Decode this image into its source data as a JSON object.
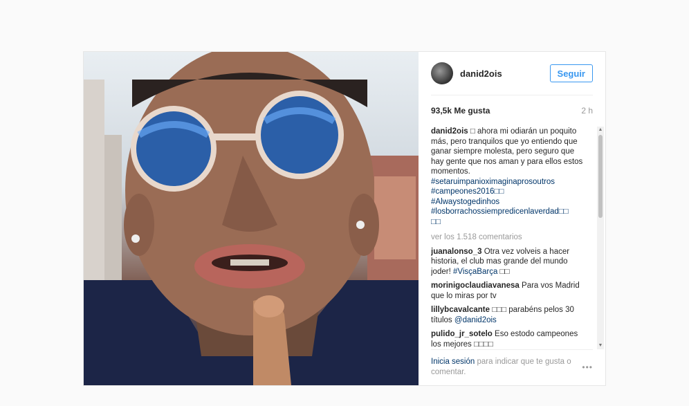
{
  "post": {
    "username": "danid2ois",
    "follow_label": "Seguir",
    "likes": "93,5k Me gusta",
    "time": "2 h",
    "caption": {
      "username": "danid2ois",
      "text": "□ ahora mi odiarán un poquito más, pero tranquilos que yo entiendo que ganar siempre molesta, pero seguro que hay gente que nos aman y para ellos estos momentos.",
      "hashtags": [
        "#setaruimpanioximaginaprosoutros",
        "#campeones2016□□",
        "#Alwaystogedinhos",
        "#losborrachossiempredicenlaverdad□□",
        "□□"
      ]
    },
    "view_more": "ver los 1.518 comentarios",
    "comments": [
      {
        "user": "juanalonso_3",
        "text": "Otra vez volveis a hacer historia, el club mas grande del mundo joder!",
        "tag": "#VisçaBarça",
        "tail": "□□"
      },
      {
        "user": "morinigoclaudiavanesa",
        "text": "Para vos Madrid que lo miras por tv",
        "tag": "",
        "tail": ""
      },
      {
        "user": "lillybcavalcante",
        "text": "□□□ parabéns pelos 30 títulos",
        "tag": "@danid2ois",
        "tail": ""
      },
      {
        "user": "pulido_jr_sotelo",
        "text": "Eso estodo campeones los mejores □□□□",
        "tag": "",
        "tail": ""
      }
    ],
    "footer": {
      "login": "Inicia sesión",
      "text": " para indicar que te gusta o comentar.",
      "more_icon": "•••"
    }
  },
  "colors": {
    "accent": "#3897f0",
    "link": "#003569",
    "muted": "#999999"
  }
}
